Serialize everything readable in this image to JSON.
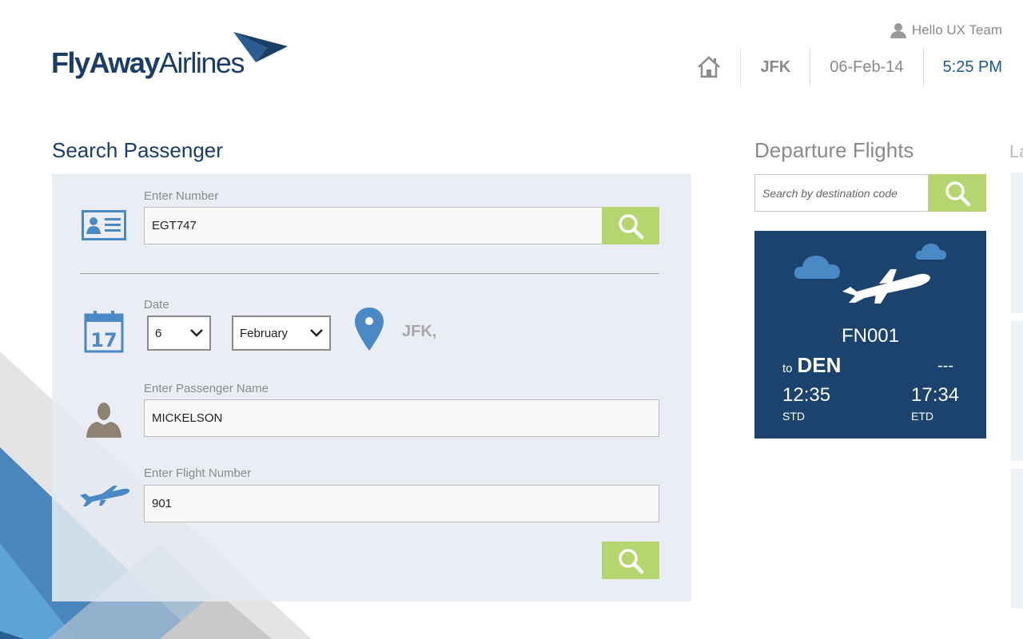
{
  "brand": {
    "name_part1": "FlyAway",
    "name_part2": "Airlines"
  },
  "header": {
    "greeting": "Hello UX Team",
    "airport_code": "JFK",
    "date": "06-Feb-14",
    "time": "5:25 PM",
    "icons": [
      "user-icon",
      "home-icon"
    ]
  },
  "search_passenger": {
    "title": "Search Passenger",
    "number_label": "Enter Number",
    "number_value": "EGT747",
    "date_label": "Date",
    "day_value": "6",
    "month_value": "February",
    "location_code": "JFK,",
    "name_label": "Enter Passenger Name",
    "name_value": "MICKELSON",
    "flight_label": "Enter Flight Number",
    "flight_value": "901",
    "icons": [
      "id-card-icon",
      "calendar-icon",
      "map-pin-icon",
      "person-icon",
      "airplane-icon",
      "search-icon"
    ],
    "calendar_day": "17"
  },
  "departure": {
    "title": "Departure Flights",
    "search_placeholder": "Search by destination code",
    "flight": {
      "number": "FN001",
      "to_prefix": "to",
      "destination": "DEN",
      "status": "---",
      "std_time": "12:35",
      "std_label": "STD",
      "etd_time": "17:34",
      "etd_label": "ETD"
    }
  },
  "latest_title_fragment": "La",
  "colors": {
    "brand_navy": "#1b436d",
    "accent_green": "#b5d56e",
    "panel_bg": "#e6ebf2",
    "icon_blue": "#4a8ac4"
  }
}
